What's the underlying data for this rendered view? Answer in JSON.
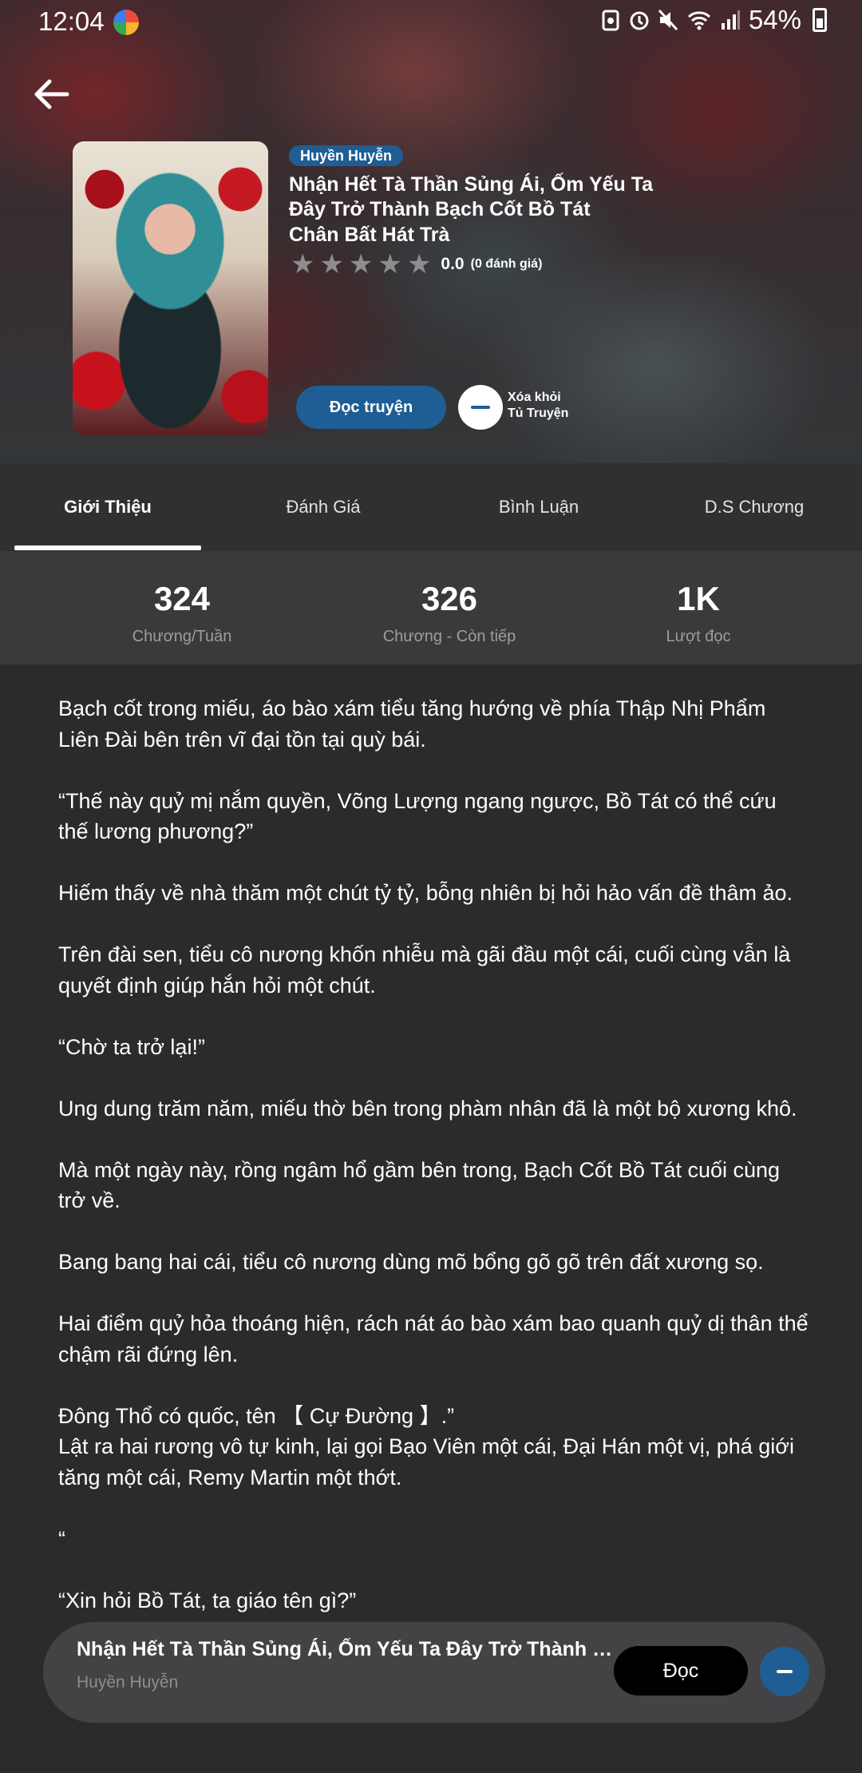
{
  "status_bar": {
    "time": "12:04",
    "battery": "54%"
  },
  "book": {
    "genre": "Huyền Huyễn",
    "title": "Nhận Hết Tà Thần Sủng Ái, Ốm Yếu Ta Đây Trở Thành Bạch Cốt Bồ Tát",
    "author": "Chân Bất Hát Trà",
    "rating_value": "0.0",
    "rating_count": "(0 đánh giá)",
    "rating_stars": 0,
    "read_label": "Đọc truyện",
    "remove_label_1": "Xóa khỏi",
    "remove_label_2": "Tủ Truyện"
  },
  "tabs": [
    "Giới Thiệu",
    "Đánh Giá",
    "Bình Luận",
    "D.S Chương"
  ],
  "active_tab": "Giới Thiệu",
  "stats": [
    {
      "value": "324",
      "label": "Chương/Tuần"
    },
    {
      "value": "326",
      "label": "Chương - Còn tiếp"
    },
    {
      "value": "1K",
      "label": "Lượt đọc"
    }
  ],
  "synopsis": [
    "Bạch cốt trong miếu, áo bào xám tiểu tăng hướng về phía Thập Nhị Phẩm Liên Đài bên trên vĩ đại tồn tại quỳ bái.",
    "“Thế này quỷ mị nắm quyền, Võng Lượng ngang ngược, Bồ Tát có thể cứu thế lương phương?”",
    "Hiếm thấy về nhà thăm một chút tỷ tỷ, bỗng nhiên bị hỏi hảo vấn đề thâm ảo.",
    "Trên đài sen, tiểu cô nương khốn nhiễu mà gãi đầu một cái, cuối cùng vẫn là quyết định giúp hắn hỏi một chút.",
    "“Chờ ta trở lại!”",
    "Ung dung trăm năm, miếu thờ bên trong phàm nhân đã là một bộ xương khô.",
    "Mà một ngày này, rồng ngâm hổ gầm bên trong, Bạch Cốt Bồ Tát cuối cùng trở về.",
    "Bang bang hai cái, tiểu cô nương dùng mõ bổng gõ gõ trên đất xương sọ.",
    "Hai điểm quỷ hỏa thoáng hiện, rách nát áo bào xám bao quanh quỷ dị thân thể chậm rãi đứng lên.",
    " Đông Thổ có quốc, tên 【 Cự Đường 】.”",
    "Lật ra hai rương vô tự kinh, lại gọi Bạo Viên một cái, Đại Hán một vị, phá giới tăng một cái, Remy Martin một thớt.",
    "“",
    "“Xin hỏi Bồ Tát, ta giáo tên gì?”"
  ],
  "mini_player": {
    "title": "Nhận Hết Tà Thần Sủng Ái, Ốm Yếu Ta Đây Trở Thành B...",
    "genre": "Huyền Huyễn",
    "read_label": "Đọc"
  }
}
